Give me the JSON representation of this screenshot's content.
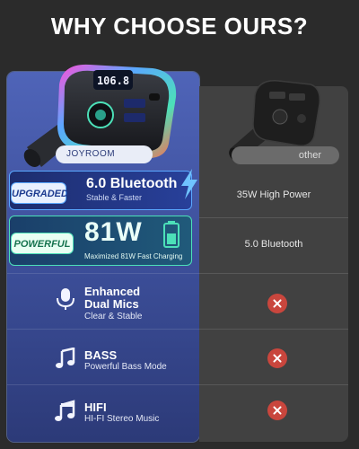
{
  "title": "WHY CHOOSE OURS?",
  "left": {
    "brand": "JOYROOM",
    "screen_value": "106.8",
    "bluetooth": {
      "badge": "UPGRADED",
      "headline": "6.0 Bluetooth",
      "sub": "Stable & Faster"
    },
    "power": {
      "badge": "POWERFUL",
      "headline": "81W",
      "sub": "Maximized 81W Fast Charging"
    },
    "features": [
      {
        "icon": "microphone-icon",
        "title_line1": "Enhanced",
        "title_line2": "Dual Mics",
        "sub": "Clear & Stable"
      },
      {
        "icon": "music-note-icon",
        "title_line1": "BASS",
        "title_line2": "",
        "sub": "Powerful Bass Mode"
      },
      {
        "icon": "music-notes-icon",
        "title_line1": "HIFI",
        "title_line2": "",
        "sub": "HI-FI Stereo Music"
      }
    ]
  },
  "right": {
    "label": "other",
    "rows": [
      "35W High Power",
      "5.0 Bluetooth"
    ]
  },
  "colors": {
    "background": "#2b2b2b",
    "left_panel": "#4f64b8",
    "right_panel": "#414141",
    "x_mark": "#c9463d",
    "accent_blue": "#5aa8ff",
    "accent_green": "#4ce0b8"
  }
}
